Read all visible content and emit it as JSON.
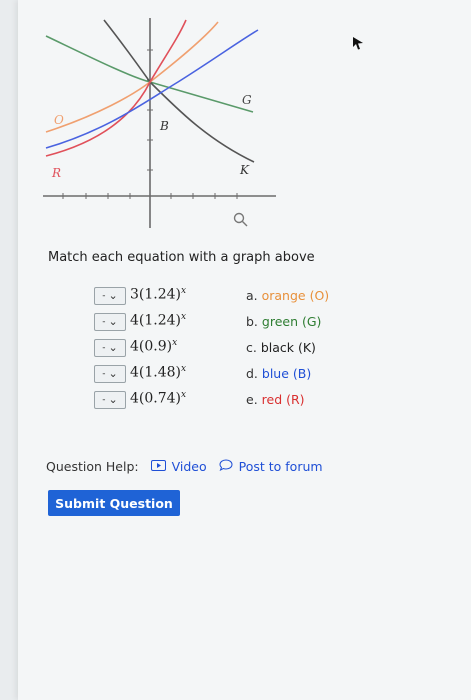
{
  "graph": {
    "curve_labels": {
      "O": "O",
      "B": "B",
      "G": "G",
      "R": "R",
      "K": "K"
    },
    "colors": {
      "orange": "#f0a070",
      "green": "#5a9a6a",
      "black": "#555555",
      "blue": "#4a63e0",
      "red": "#e0505a"
    }
  },
  "prompt": "Match each equation with a graph above",
  "equations": [
    {
      "base": "3(1.24)",
      "exp": "x",
      "select": "-"
    },
    {
      "base": "4(1.24)",
      "exp": "x",
      "select": "-"
    },
    {
      "base": "4(0.9)",
      "exp": "x",
      "select": "-"
    },
    {
      "base": "4(1.48)",
      "exp": "x",
      "select": "-"
    },
    {
      "base": "4(0.74)",
      "exp": "x",
      "select": "-"
    }
  ],
  "options": [
    {
      "prefix": "a. ",
      "text": "orange (O)",
      "color": "#e8903a"
    },
    {
      "prefix": "b. ",
      "text": "green (G)",
      "color": "#2e7d32"
    },
    {
      "prefix": "c. ",
      "text": "black (K)",
      "color": "#222222"
    },
    {
      "prefix": "d. ",
      "text": "blue (B)",
      "color": "#1f4fd6"
    },
    {
      "prefix": "e. ",
      "text": "red (R)",
      "color": "#d93030"
    }
  ],
  "help": {
    "label": "Question Help:",
    "video": "Video",
    "forum": "Post to forum"
  },
  "submit_label": "Submit Question"
}
